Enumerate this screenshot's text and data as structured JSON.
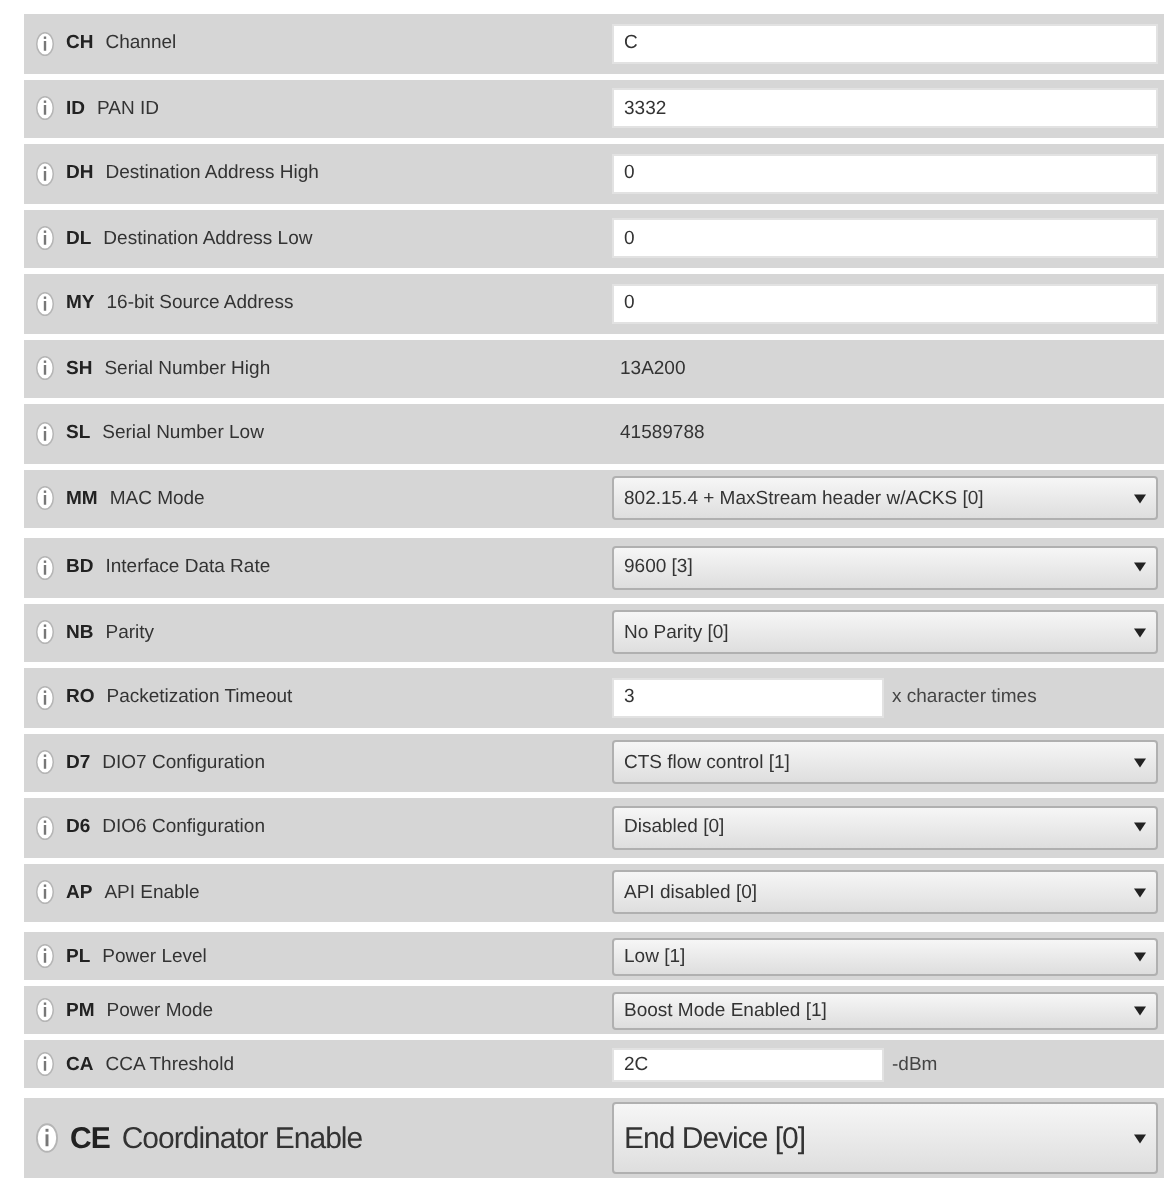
{
  "groups": [
    {
      "compact": false,
      "large": false,
      "rows": [
        {
          "code": "CH",
          "name": "Channel",
          "kind": "text",
          "value": "C"
        },
        {
          "code": "ID",
          "name": "PAN ID",
          "kind": "text",
          "value": "3332"
        },
        {
          "code": "DH",
          "name": "Destination Address High",
          "kind": "text",
          "value": "0"
        },
        {
          "code": "DL",
          "name": "Destination Address Low",
          "kind": "text",
          "value": "0"
        },
        {
          "code": "MY",
          "name": "16-bit Source Address",
          "kind": "text",
          "value": "0"
        },
        {
          "code": "SH",
          "name": "Serial Number High",
          "kind": "readonly",
          "value": "13A200"
        },
        {
          "code": "SL",
          "name": "Serial Number Low",
          "kind": "readonly",
          "value": "41589788"
        },
        {
          "code": "MM",
          "name": "MAC Mode",
          "kind": "select",
          "value": "802.15.4 + MaxStream header w/ACKS [0]"
        }
      ]
    },
    {
      "compact": false,
      "large": false,
      "rows": [
        {
          "code": "BD",
          "name": "Interface Data Rate",
          "kind": "select",
          "value": "9600 [3]"
        },
        {
          "code": "NB",
          "name": "Parity",
          "kind": "select",
          "value": "No Parity [0]"
        },
        {
          "code": "RO",
          "name": "Packetization Timeout",
          "kind": "short",
          "value": "3",
          "unit": "x character times"
        },
        {
          "code": "D7",
          "name": "DIO7 Configuration",
          "kind": "select",
          "value": "CTS flow control [1]"
        },
        {
          "code": "D6",
          "name": "DIO6 Configuration",
          "kind": "select",
          "value": "Disabled [0]"
        },
        {
          "code": "AP",
          "name": "API Enable",
          "kind": "select",
          "value": "API disabled [0]"
        }
      ]
    },
    {
      "compact": true,
      "large": false,
      "rows": [
        {
          "code": "PL",
          "name": "Power Level",
          "kind": "select",
          "value": "Low [1]"
        },
        {
          "code": "PM",
          "name": "Power Mode",
          "kind": "select",
          "value": "Boost Mode Enabled [1]"
        },
        {
          "code": "CA",
          "name": "CCA Threshold",
          "kind": "short",
          "value": "2C",
          "unit": "-dBm"
        }
      ]
    },
    {
      "compact": false,
      "large": true,
      "rows": [
        {
          "code": "CE",
          "name": "Coordinator Enable",
          "kind": "select",
          "value": "End Device [0]"
        }
      ]
    }
  ]
}
